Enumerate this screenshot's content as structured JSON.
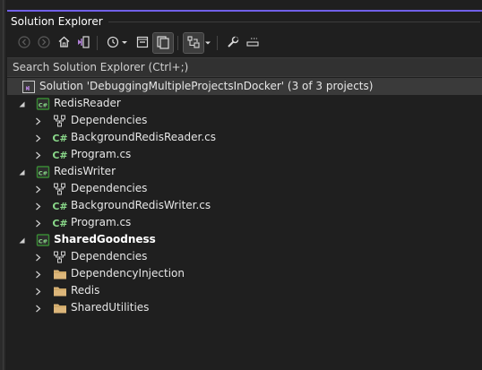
{
  "window": {
    "title": "Solution Explorer"
  },
  "toolbar": {
    "buttons": [
      {
        "name": "back-icon"
      },
      {
        "name": "forward-icon"
      },
      {
        "name": "home-icon"
      },
      {
        "name": "switch-views-icon"
      },
      {
        "name": "pending-changes-filter-icon"
      },
      {
        "name": "collapse-all-icon"
      },
      {
        "name": "show-all-files-icon"
      },
      {
        "name": "sync-with-active-document-icon"
      },
      {
        "name": "properties-icon"
      },
      {
        "name": "preview-selected-items-icon"
      }
    ]
  },
  "search": {
    "placeholder": "Search Solution Explorer (Ctrl+;)",
    "value": ""
  },
  "tree": {
    "solution": "Solution 'DebuggingMultipleProjectsInDocker' (3 of 3 projects)",
    "projects": [
      {
        "name": "RedisReader",
        "bold": false,
        "items": [
          {
            "label": "Dependencies",
            "type": "dependencies"
          },
          {
            "label": "BackgroundRedisReader.cs",
            "type": "cs"
          },
          {
            "label": "Program.cs",
            "type": "cs"
          }
        ]
      },
      {
        "name": "RedisWriter",
        "bold": false,
        "items": [
          {
            "label": "Dependencies",
            "type": "dependencies"
          },
          {
            "label": "BackgroundRedisWriter.cs",
            "type": "cs"
          },
          {
            "label": "Program.cs",
            "type": "cs"
          }
        ]
      },
      {
        "name": "SharedGoodness",
        "bold": true,
        "items": [
          {
            "label": "Dependencies",
            "type": "dependencies"
          },
          {
            "label": "DependencyInjection",
            "type": "folder"
          },
          {
            "label": "Redis",
            "type": "folder"
          },
          {
            "label": "SharedUtilities",
            "type": "folder"
          }
        ]
      }
    ]
  },
  "colors": {
    "accent": "#7160e8",
    "csharp": "#8ad98a",
    "folder": "#dcb67a",
    "project": "#388a34"
  }
}
